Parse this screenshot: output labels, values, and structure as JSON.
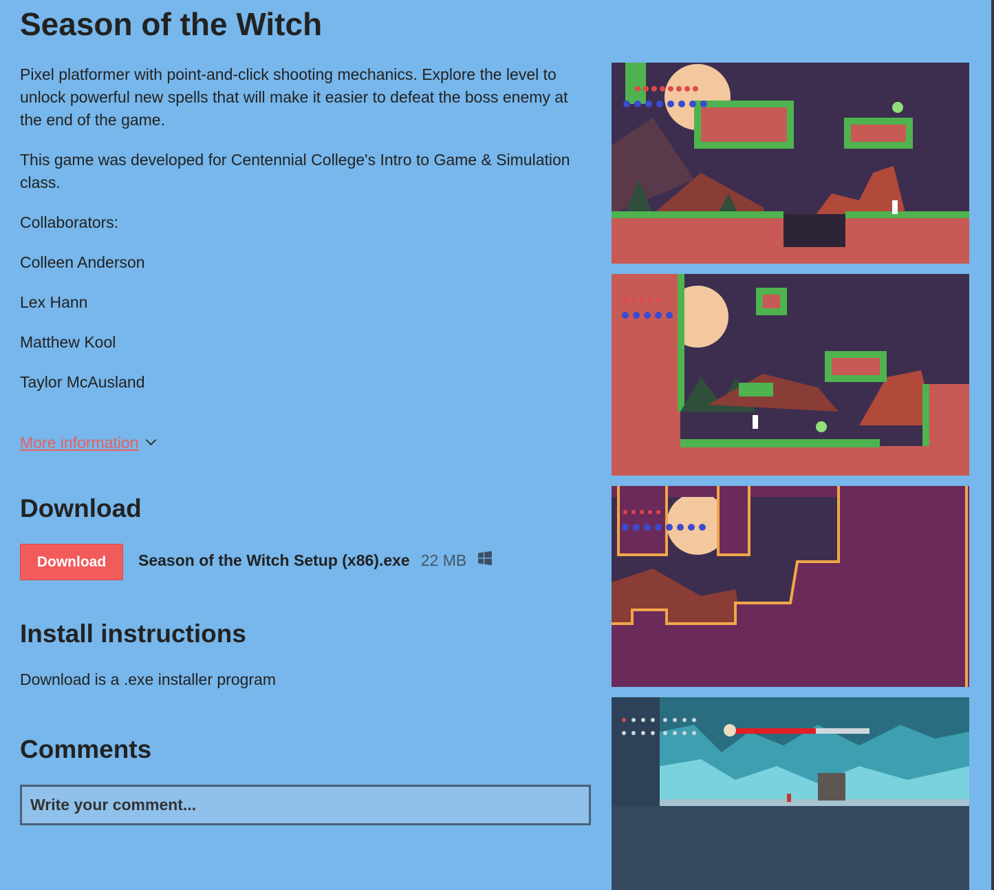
{
  "game": {
    "title": "Season of the Witch",
    "description": [
      "Pixel platformer with point-and-click shooting mechanics.  Explore the level to unlock powerful new spells that will make it easier to defeat the boss enemy at the end of the game.",
      "This game was developed for Centennial College's Intro to Game & Simulation class.",
      "Collaborators:",
      "Colleen Anderson",
      "Lex Hann",
      "Matthew Kool",
      "Taylor McAusland"
    ],
    "more_info_label": "More information"
  },
  "download": {
    "heading": "Download",
    "button_label": "Download",
    "file_name": "Season of the Witch Setup (x86).exe",
    "file_size": "22 MB",
    "platform_icon": "windows-icon"
  },
  "install": {
    "heading": "Install instructions",
    "text": "Download is a .exe installer program"
  },
  "comments": {
    "heading": "Comments",
    "placeholder": "Write your comment..."
  },
  "colors": {
    "background": "#77b7eb",
    "accent": "#f25b5b",
    "link": "#e86060"
  }
}
